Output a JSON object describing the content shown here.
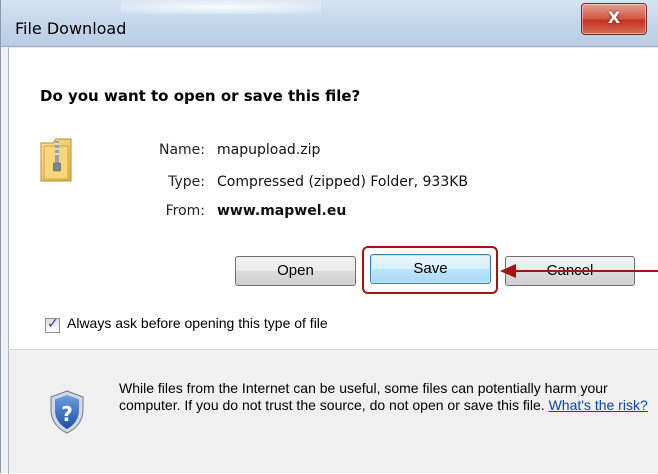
{
  "window": {
    "title": "File Download",
    "close_label": "X"
  },
  "dialog": {
    "question": "Do you want to open or save this file?",
    "file_icon": "zip-folder-icon",
    "name_label": "Name:",
    "name_value": "mapupload.zip",
    "type_label": "Type:",
    "type_value": "Compressed (zipped) Folder, 933KB",
    "from_label": "From:",
    "from_value": "www.mapwel.eu"
  },
  "buttons": {
    "open_label": "Open",
    "save_label": "Save",
    "cancel_label": "Cancel"
  },
  "checkbox": {
    "checked": true,
    "label": "Always ask before opening this type of file"
  },
  "warning": {
    "icon": "shield-question-icon",
    "text": "While files from the Internet can be useful, some files can potentially harm your computer. If you do not trust the source, do not open or save this file. ",
    "link_text": "What's the risk?"
  },
  "annotation": {
    "highlight_color": "#a31515",
    "target": "Save"
  },
  "colors": {
    "close_button": "#c0331f",
    "save_button_border": "#3c7fb1",
    "link": "#0645ad"
  }
}
